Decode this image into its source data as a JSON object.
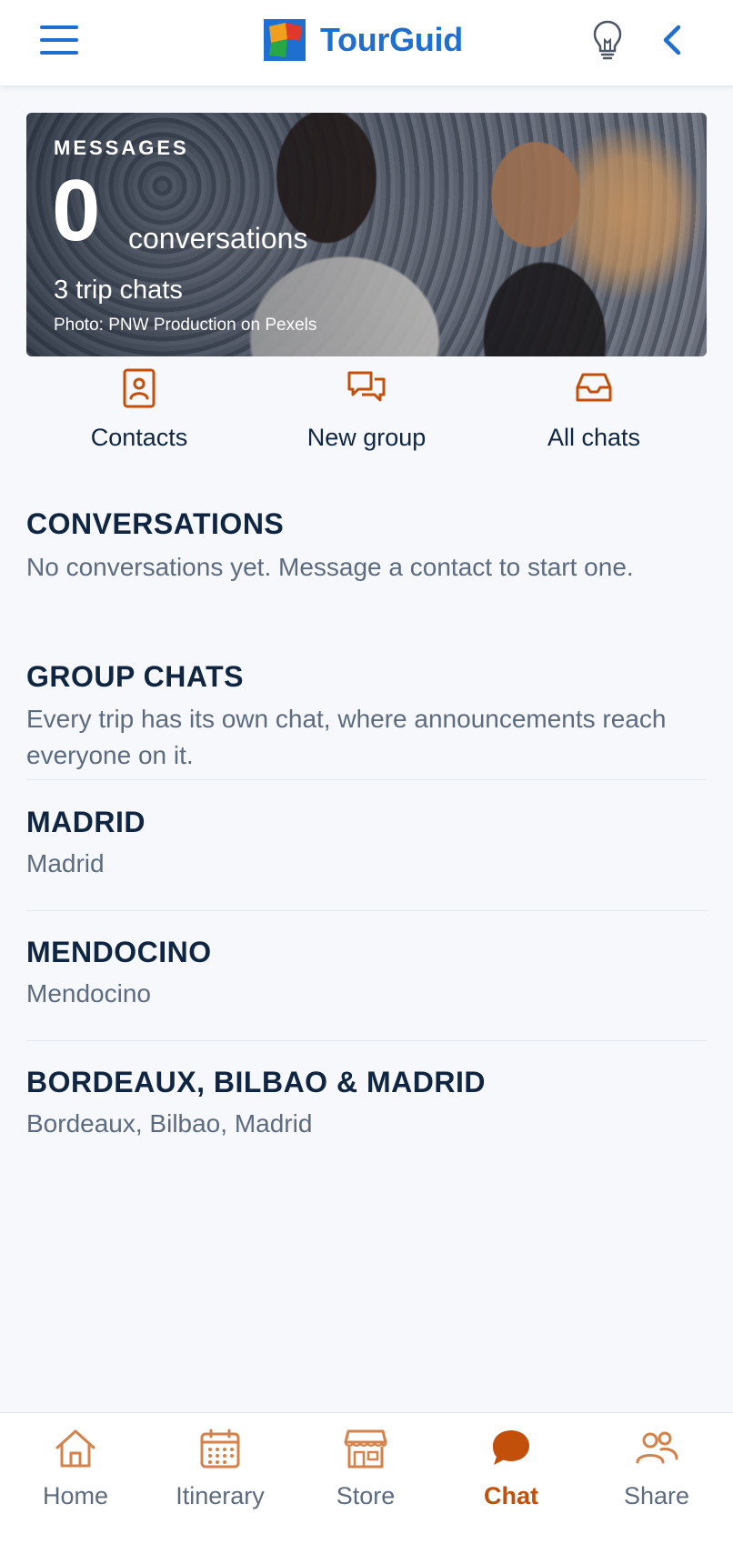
{
  "header": {
    "brand_name": "TourGuid",
    "icons": [
      "menu-icon",
      "tourguid-logo-icon",
      "lightbulb-icon",
      "chevron-left-icon"
    ]
  },
  "hero": {
    "kicker": "MESSAGES",
    "count": "0",
    "count_label": "conversations",
    "subtitle": "3 trip chats",
    "photo_credit": "Photo: PNW Production on Pexels"
  },
  "actions": [
    {
      "label": "Contacts",
      "icon": "contacts-book-icon"
    },
    {
      "label": "New group",
      "icon": "chat-bubbles-icon"
    },
    {
      "label": "All chats",
      "icon": "inbox-icon"
    }
  ],
  "conversations": {
    "title": "CONVERSATIONS",
    "empty_text": "No conversations yet. Message a contact to start one."
  },
  "group_chats": {
    "title": "GROUP CHATS",
    "description": "Every trip has its own chat, where announcements reach everyone on it.",
    "items": [
      {
        "name": "MADRID",
        "places": "Madrid"
      },
      {
        "name": "MENDOCINO",
        "places": "Mendocino"
      },
      {
        "name": "BORDEAUX, BILBAO & MADRID",
        "places": "Bordeaux, Bilbao, Madrid"
      }
    ]
  },
  "bottom_nav": {
    "items": [
      {
        "label": "Home",
        "icon": "home-icon"
      },
      {
        "label": "Itinerary",
        "icon": "calendar-icon"
      },
      {
        "label": "Store",
        "icon": "store-icon"
      },
      {
        "label": "Chat",
        "icon": "chat-bubble-icon",
        "active": true
      },
      {
        "label": "Share",
        "icon": "users-icon"
      }
    ]
  },
  "colors": {
    "brand_blue": "#1f6fd1",
    "accent_orange": "#c24f0a",
    "text_dark": "#0f2541",
    "text_muted": "#5c6b80",
    "background": "#f6f8fb"
  }
}
